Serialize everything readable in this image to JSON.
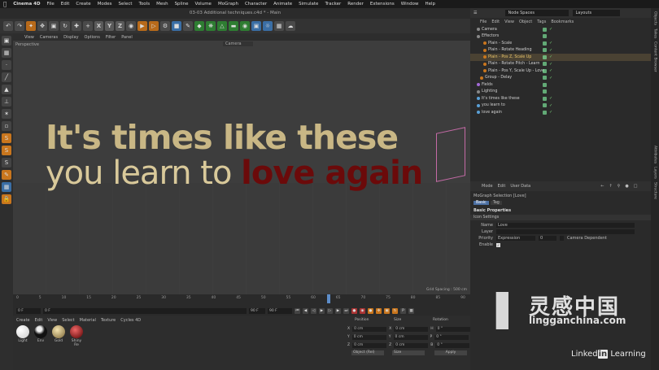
{
  "mac_menu": {
    "app": "Cinema 4D",
    "items": [
      "File",
      "Edit",
      "Create",
      "Modes",
      "Select",
      "Tools",
      "Mesh",
      "Spline",
      "Volume",
      "MoGraph",
      "Character",
      "Animate",
      "Simulate",
      "Tracker",
      "Render",
      "Extensions",
      "Window",
      "Help"
    ]
  },
  "window": {
    "title": "03-03 Additional techniques.c4d * - Main"
  },
  "toolbar": {
    "xyz": [
      "X",
      "Y",
      "Z"
    ]
  },
  "viewport": {
    "menu": [
      "View",
      "Cameras",
      "Display",
      "Options",
      "Filter",
      "Panel"
    ],
    "label": "Perspective",
    "camera": "Camera",
    "text_line1": "It's times like these",
    "text_line2a": "you learn to ",
    "text_line2b": "love again",
    "grid_spacing": "Grid Spacing : 500 cm"
  },
  "timeline": {
    "ticks": [
      "0",
      "5",
      "10",
      "15",
      "20",
      "25",
      "30",
      "35",
      "40",
      "45",
      "50",
      "55",
      "60",
      "65",
      "70",
      "75",
      "80",
      "85",
      "90"
    ],
    "start": "0 F",
    "current": "0 F",
    "end": "90 F",
    "end2": "90 F",
    "frame_display": "67 F"
  },
  "materials": {
    "menu": [
      "Create",
      "Edit",
      "View",
      "Select",
      "Material",
      "Texture",
      "Cycles 4D"
    ],
    "items": [
      {
        "name": "Light",
        "color": "#f2f2f2"
      },
      {
        "name": "Env",
        "color": "#222"
      },
      {
        "name": "Gold",
        "color": "#b39a62"
      },
      {
        "name": "Shiny Re",
        "color": "#8a0f12"
      }
    ]
  },
  "coords": {
    "headers": [
      "Position",
      "Size",
      "Rotation"
    ],
    "rows": [
      {
        "axis": "X",
        "pos": "0 cm",
        "size": "0 cm",
        "rl": "H",
        "rot": "0 °"
      },
      {
        "axis": "Y",
        "pos": "0 cm",
        "size": "0 cm",
        "rl": "P",
        "rot": "0 °"
      },
      {
        "axis": "Z",
        "pos": "0 cm",
        "size": "0 cm",
        "rl": "B",
        "rot": "0 °"
      }
    ],
    "mode1": "Object (Rel)",
    "mode2": "Size",
    "apply": "Apply"
  },
  "object_manager": {
    "menu": [
      "File",
      "Edit",
      "View",
      "Object",
      "Tags",
      "Bookmarks"
    ],
    "node_spaces": "Node Spaces",
    "layouts": "Layouts",
    "objects": [
      {
        "name": "Camera",
        "indent": 0,
        "dot": "#888",
        "sel": false
      },
      {
        "name": "Effectors",
        "indent": 0,
        "dot": "#888",
        "sel": false
      },
      {
        "name": "Plain - Scale",
        "indent": 1,
        "dot": "#c9761d",
        "sel": false
      },
      {
        "name": "Plain - Rotate Heading",
        "indent": 1,
        "dot": "#c9761d",
        "sel": false
      },
      {
        "name": "Plain - Pos Z, Scale Up",
        "indent": 1,
        "dot": "#c9761d",
        "sel": true
      },
      {
        "name": "Plain - Rotate Pitch - Learn",
        "indent": 1,
        "dot": "#c9761d",
        "sel": false
      },
      {
        "name": "Plain - Pos Y, Scale Up - Love",
        "indent": 1,
        "dot": "#c9761d",
        "sel": false
      },
      {
        "name": "Group - Delay",
        "indent": 1,
        "dot": "#c9761d",
        "sel": false
      },
      {
        "name": "Fields",
        "indent": 0,
        "dot": "#a36ad6",
        "sel": false
      },
      {
        "name": "Lighting",
        "indent": 0,
        "dot": "#888",
        "sel": false
      },
      {
        "name": "It's times like these",
        "indent": 0,
        "dot": "#5aa0d6",
        "sel": false
      },
      {
        "name": "you learn to",
        "indent": 0,
        "dot": "#5aa0d6",
        "sel": false
      },
      {
        "name": "love again",
        "indent": 0,
        "dot": "#5aa0d6",
        "sel": false
      }
    ]
  },
  "attributes": {
    "menu": [
      "Mode",
      "Edit",
      "User Data"
    ],
    "title": "MoGraph Selection [Love]",
    "tabs": [
      "Basic",
      "Tag"
    ],
    "section": "Basic Properties",
    "subsection": "Icon Settings",
    "name_label": "Name",
    "name_value": "Love",
    "layer_label": "Layer",
    "priority_label": "Priority",
    "priority_value": "Expression",
    "priority_num": "0",
    "camera_dependent": "Camera Dependent",
    "enable_label": "Enable"
  },
  "right_tabs": [
    "Objects",
    "Takes",
    "Content Browser",
    "Attributes",
    "Layers",
    "Structure"
  ],
  "watermark": {
    "cn": "灵感中国",
    "site": "lingganchina.com",
    "li_a": "Linked",
    "li_b": "in",
    "li_c": " Learning"
  }
}
